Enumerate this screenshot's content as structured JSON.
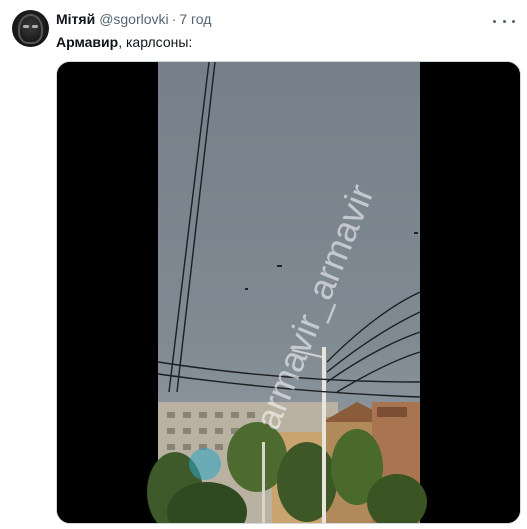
{
  "tweet": {
    "author_name": "Мітяй",
    "handle": "@sgorlovki",
    "separator": "·",
    "time": "7 год",
    "text_bold": "Армавир",
    "text_rest": ", карлсоны:",
    "more_icon": "more-horizontal-icon",
    "media": {
      "type": "video",
      "watermark": "armavir_armavir",
      "sky_color": "#7e8890",
      "frame_color": "#000000"
    }
  }
}
